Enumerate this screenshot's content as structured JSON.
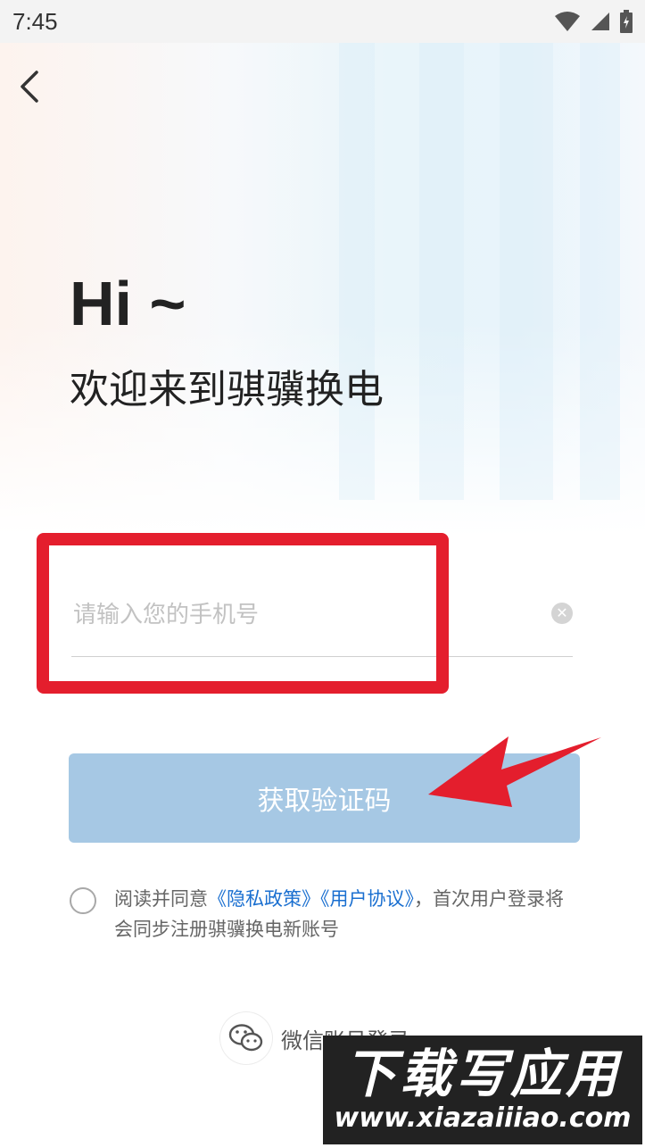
{
  "status_bar": {
    "time": "7:45"
  },
  "header": {
    "back_icon": "chevron-left-icon"
  },
  "greeting": {
    "hi": "Hi ~",
    "welcome": "欢迎来到骐骥换电"
  },
  "phone_field": {
    "placeholder": "请输入您的手机号",
    "value": "",
    "clear_icon": "clear-icon"
  },
  "get_code_button": {
    "label": "获取验证码"
  },
  "agreement": {
    "prefix": "阅读并同意",
    "privacy_link": "《隐私政策》",
    "user_link": "《用户协议》",
    "suffix": "，首次用户登录将会同步注册骐骥换电新账号"
  },
  "wechat_login": {
    "label": "微信账号登录"
  },
  "watermark": {
    "title": "下载写应用",
    "url": "www.xiazaiiiao.com"
  },
  "colors": {
    "button_bg": "#a6c8e4",
    "link": "#1a6fd0",
    "annotation_red": "#e41e2d"
  }
}
